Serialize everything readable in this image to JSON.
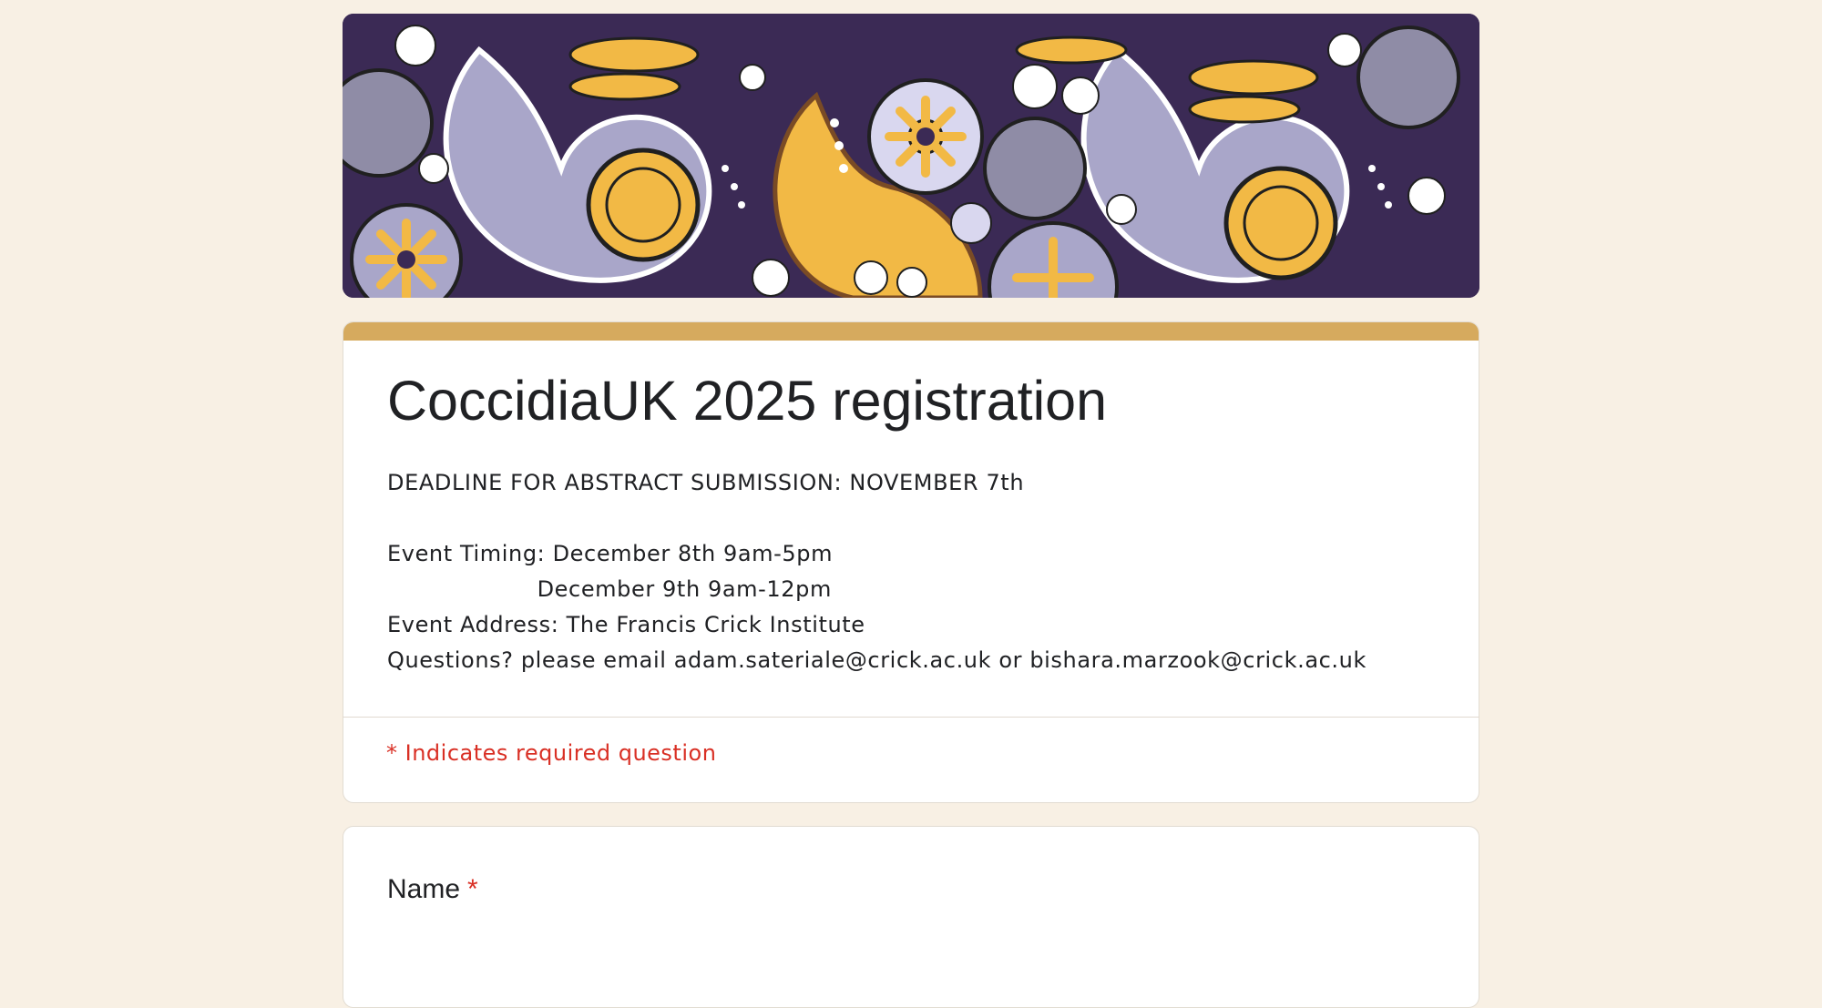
{
  "form": {
    "title": "CoccidiaUK 2025 registration",
    "description": [
      "DEADLINE FOR ABSTRACT SUBMISSION: NOVEMBER 7th",
      "",
      "Event Timing: December 8th 9am-5pm",
      "                    December 9th 9am-12pm",
      "Event Address: The Francis Crick Institute",
      "Questions? please email adam.sateriale@crick.ac.uk or bishara.marzook@crick.ac.uk"
    ],
    "required_note": "* Indicates required question"
  },
  "questions": [
    {
      "label": "Name",
      "required_marker": "*"
    }
  ],
  "colors": {
    "page_background": "#f8f0e4",
    "accent": "#d6aa5e",
    "required": "#d93025",
    "banner_base": "#3b2a55"
  },
  "icons": {
    "banner": "paisley-pattern-image"
  }
}
